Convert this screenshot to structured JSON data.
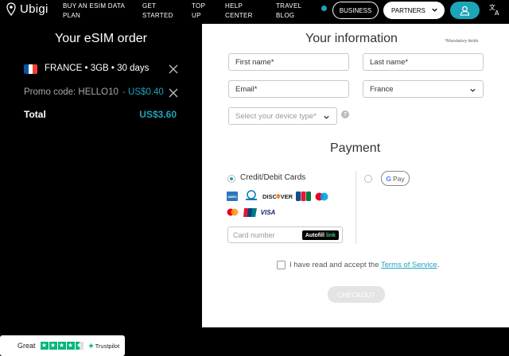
{
  "nav": {
    "brand": "Ubigi",
    "links": [
      {
        "label": "Buy an eSIM data plan"
      },
      {
        "label": "Get started"
      },
      {
        "label": "Top up"
      },
      {
        "label": "Help center"
      },
      {
        "label": "Travel blog"
      }
    ],
    "business_label": "BUSINESS",
    "partners_label": "PARTNERS",
    "accent_color": "#1da4b8",
    "icons": [
      "location-pin-icon",
      "chevron-down-icon",
      "user-icon",
      "translate-icon"
    ]
  },
  "order": {
    "title": "Your eSIM order",
    "plan": "FRANCE • 3GB • 30 days",
    "flag_colors": [
      "#0055a4",
      "#ffffff",
      "#ef4135"
    ],
    "promo_label": "Promo code: HELLO10",
    "promo_value": "- US$0.40",
    "total_label": "Total",
    "total_value": "US$3.60"
  },
  "info": {
    "title": "Your information",
    "mandatory_note": "*Mandatory fields",
    "first_name_placeholder": "First name*",
    "last_name_placeholder": "Last name*",
    "email_placeholder": "Email*",
    "country_value": "France",
    "device_placeholder": "Select your device type*",
    "help_glyph": "?"
  },
  "payment": {
    "title": "Payment",
    "credit_label": "Credit/Debit Cards",
    "gpay_g": "G",
    "gpay_label": "Pay",
    "card_brands": [
      "AMEX",
      "Diners",
      "DISCOVER",
      "JCB",
      "Maestro",
      "Mastercard",
      "UnionPay",
      "VISA"
    ],
    "card_number_placeholder": "Card number",
    "autofill_label": "Autofill",
    "autofill_link": "link",
    "terms_prefix": "I have read and accept the ",
    "terms_link": "Terms of Service",
    "terms_suffix": ".",
    "checkout_label": "CHECKOUT"
  },
  "trustpilot": {
    "rating_word": "Great",
    "stars": 4.5,
    "brand": "Trustpilot",
    "star_glyph": "★"
  }
}
